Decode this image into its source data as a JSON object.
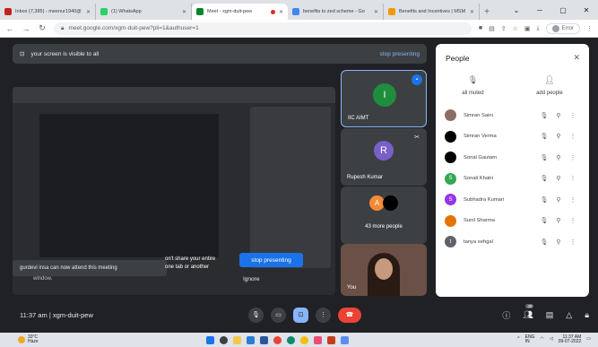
{
  "browser": {
    "tabs": [
      {
        "title": "Inbox (7,385) - meenur1940@",
        "fav_color": "#c5221f",
        "active": false
      },
      {
        "title": "(1) WhatsApp",
        "fav_color": "#25d366",
        "active": false
      },
      {
        "title": "Meet - xgm-duit-pew",
        "fav_color": "#00832d",
        "active": true
      },
      {
        "title": "benefits to zed scheme - Go",
        "fav_color": "#4285f4",
        "active": false
      },
      {
        "title": "Benefits and Incentives | MSM",
        "fav_color": "#f29900",
        "active": false
      }
    ],
    "url": "meet.google.com/xgm-duit-pew?pli=1&authuser=1",
    "error_label": "Error"
  },
  "banner": {
    "text": "your screen is visible to all",
    "stop_label": "stop presenting"
  },
  "share_overlay": {
    "toast": "gurdevi insa can now attend this meeting",
    "share_text": "one tab or another",
    "share_text_prefix": "on't share your entire",
    "stop_button": "stop presenting",
    "ignore": "Ignore",
    "window_label": "window."
  },
  "tiles": [
    {
      "name": "IIC AIMT",
      "initial": "I",
      "color": "#1e8e3e"
    },
    {
      "name": "Rupesh Kumar",
      "initial": "R",
      "color": "#7b5fc9"
    },
    {
      "name": "43 more people",
      "initial": "A",
      "color": "#f28b35"
    },
    {
      "name": "You",
      "initial": "",
      "color": "#6a5046"
    }
  ],
  "people": {
    "title": "People",
    "all_muted": "all muted",
    "add_people": "add people",
    "list": [
      {
        "name": "Simran Saini",
        "initial": "",
        "color": "#8d6e63"
      },
      {
        "name": "Simran Verma",
        "initial": "",
        "color": "#000000"
      },
      {
        "name": "Sonal Gautam",
        "initial": "",
        "color": "#000000"
      },
      {
        "name": "Sonali Khatri",
        "initial": "S",
        "color": "#34a853"
      },
      {
        "name": "Subhadra Kumari",
        "initial": "S",
        "color": "#9334e6"
      },
      {
        "name": "Sunil Sharma",
        "initial": "",
        "color": "#e37400"
      },
      {
        "name": "tanya sehgal",
        "initial": "t",
        "color": "#5f6368"
      }
    ]
  },
  "bottom": {
    "time": "11:37 am",
    "code": "xgm-duit-pew",
    "people_count": "49"
  },
  "taskbar": {
    "temp": "33°C",
    "weather": "Haze",
    "lang": "ENG",
    "region": "IN",
    "clock_time": "11:37 AM",
    "clock_date": "09-07-2022"
  }
}
